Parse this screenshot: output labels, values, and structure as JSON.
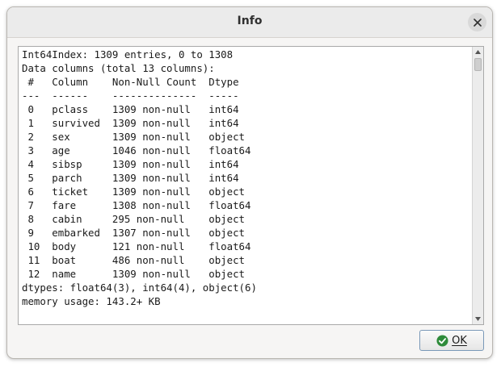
{
  "window": {
    "title": "Info"
  },
  "info_text": {
    "lines": [
      "Int64Index: 1309 entries, 0 to 1308",
      "Data columns (total 13 columns):",
      " #   Column    Non-Null Count  Dtype",
      "---  ------    --------------  -----",
      " 0   pclass    1309 non-null   int64",
      " 1   survived  1309 non-null   int64",
      " 2   sex       1309 non-null   object",
      " 3   age       1046 non-null   float64",
      " 4   sibsp     1309 non-null   int64",
      " 5   parch     1309 non-null   int64",
      " 6   ticket    1309 non-null   object",
      " 7   fare      1308 non-null   float64",
      " 8   cabin     295 non-null    object",
      " 9   embarked  1307 non-null   object",
      " 10  body      121 non-null    float64",
      " 11  boat      486 non-null    object",
      " 12  name      1309 non-null   object",
      "dtypes: float64(3), int64(4), object(6)",
      "memory usage: 143.2+ KB"
    ]
  },
  "buttons": {
    "ok_label": "OK"
  },
  "icons": {
    "close": "close-icon",
    "ok": "check-circle-icon"
  },
  "colors": {
    "ok_icon": "#2e8b3a"
  }
}
